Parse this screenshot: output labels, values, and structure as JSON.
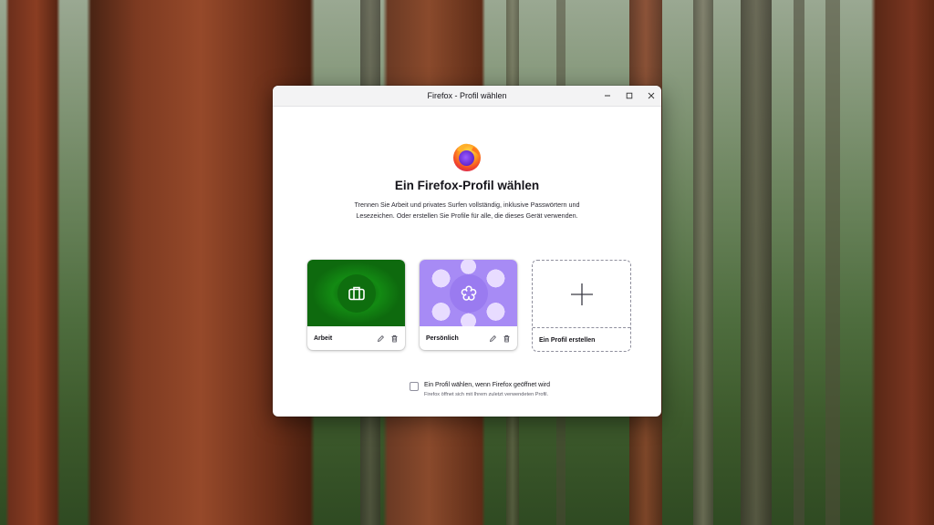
{
  "window": {
    "title": "Firefox - Profil wählen",
    "controls": {
      "minimize": "minimize-icon",
      "maximize": "maximize-icon",
      "close": "close-icon"
    }
  },
  "main": {
    "logo_icon": "firefox-logo",
    "heading": "Ein Firefox-Profil wählen",
    "description": "Trennen Sie Arbeit und privates Surfen vollständig, inklusive Passwörtern und Lesezeichen. Oder erstellen Sie Profile für alle, die dieses Gerät verwenden.",
    "profiles": [
      {
        "name": "Arbeit",
        "avatar_icon": "briefcase-icon",
        "theme_color": "#138a13",
        "edit_icon": "pencil-icon",
        "delete_icon": "trash-icon"
      },
      {
        "name": "Persönlich",
        "avatar_icon": "flower-icon",
        "theme_color": "#a78bf5",
        "edit_icon": "pencil-icon",
        "delete_icon": "trash-icon"
      }
    ],
    "new_profile": {
      "label": "Ein Profil erstellen",
      "icon": "plus-icon"
    },
    "startup_option": {
      "checked": false,
      "label": "Ein Profil wählen, wenn Firefox geöffnet wird",
      "hint": "Firefox öffnet sich mit Ihrem zuletzt verwendeten Profil."
    }
  }
}
